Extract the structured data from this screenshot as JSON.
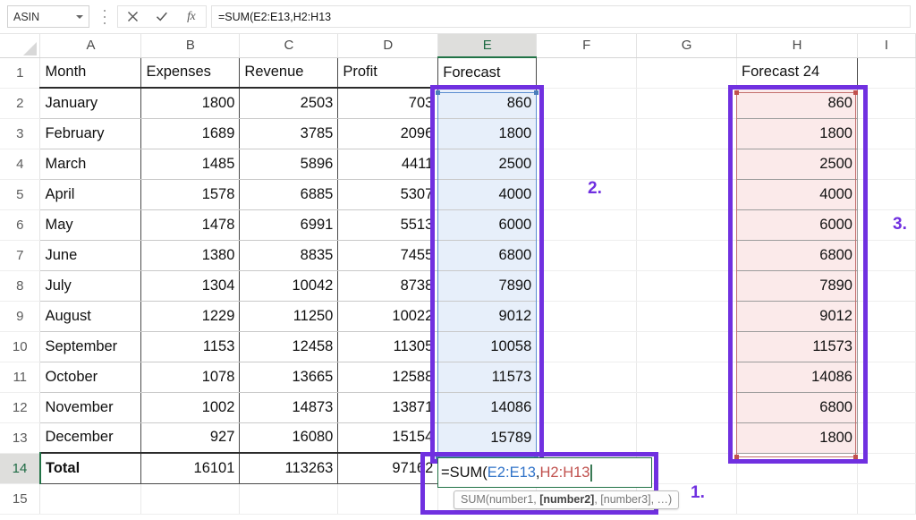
{
  "formula_bar": {
    "name_box_value": "ASIN",
    "cancel_icon": "close-icon",
    "confirm_icon": "check-icon",
    "function_icon": "fx-icon",
    "formula_text": "=SUM(E2:E13,H2:H13"
  },
  "grid": {
    "column_headers": [
      "A",
      "B",
      "C",
      "D",
      "E",
      "F",
      "G",
      "H",
      "I"
    ],
    "active_column": "E",
    "active_row": "14",
    "row_numbers": [
      "1",
      "2",
      "3",
      "4",
      "5",
      "6",
      "7",
      "8",
      "9",
      "10",
      "11",
      "12",
      "13",
      "14",
      "15"
    ],
    "headers_row": {
      "a": "Month",
      "b": "Expenses",
      "c": "Revenue",
      "d": "Profit",
      "e": "Forecast",
      "h": "Forecast 24"
    },
    "rows": [
      {
        "r": "2",
        "month": "January",
        "expenses": "1800",
        "revenue": "2503",
        "profit": "703",
        "forecast": "860",
        "forecast24": "860"
      },
      {
        "r": "3",
        "month": "February",
        "expenses": "1689",
        "revenue": "3785",
        "profit": "2096",
        "forecast": "1800",
        "forecast24": "1800"
      },
      {
        "r": "4",
        "month": "March",
        "expenses": "1485",
        "revenue": "5896",
        "profit": "4411",
        "forecast": "2500",
        "forecast24": "2500"
      },
      {
        "r": "5",
        "month": "April",
        "expenses": "1578",
        "revenue": "6885",
        "profit": "5307",
        "forecast": "4000",
        "forecast24": "4000"
      },
      {
        "r": "6",
        "month": "May",
        "expenses": "1478",
        "revenue": "6991",
        "profit": "5513",
        "forecast": "6000",
        "forecast24": "6000"
      },
      {
        "r": "7",
        "month": "June",
        "expenses": "1380",
        "revenue": "8835",
        "profit": "7455",
        "forecast": "6800",
        "forecast24": "6800"
      },
      {
        "r": "8",
        "month": "July",
        "expenses": "1304",
        "revenue": "10042",
        "profit": "8738",
        "forecast": "7890",
        "forecast24": "7890"
      },
      {
        "r": "9",
        "month": "August",
        "expenses": "1229",
        "revenue": "11250",
        "profit": "10022",
        "forecast": "9012",
        "forecast24": "9012"
      },
      {
        "r": "10",
        "month": "September",
        "expenses": "1153",
        "revenue": "12458",
        "profit": "11305",
        "forecast": "10058",
        "forecast24": "11573"
      },
      {
        "r": "11",
        "month": "October",
        "expenses": "1078",
        "revenue": "13665",
        "profit": "12588",
        "forecast": "11573",
        "forecast24": "14086"
      },
      {
        "r": "12",
        "month": "November",
        "expenses": "1002",
        "revenue": "14873",
        "profit": "13871",
        "forecast": "14086",
        "forecast24": "6800"
      },
      {
        "r": "13",
        "month": "December",
        "expenses": "927",
        "revenue": "16080",
        "profit": "15154",
        "forecast": "15789",
        "forecast24": "1800"
      }
    ],
    "total_row": {
      "r": "14",
      "label": "Total",
      "expenses": "16101",
      "revenue": "113263",
      "profit": "97162"
    }
  },
  "active_cell_edit": {
    "prefix": "=SUM(",
    "ref1": "E2:E13",
    "separator": ",",
    "ref2": "H2:H13"
  },
  "tooltip": {
    "prefix": "SUM(number1, ",
    "bold": "[number2]",
    "suffix": ", [number3], …)"
  },
  "annotations": {
    "one": "1.",
    "two": "2.",
    "three": "3."
  },
  "colors": {
    "annotation_purple": "#7030e0",
    "selection_blue": "#e7effa",
    "selection_pink": "#fbeaea",
    "ref1_blue": "#2f72c8",
    "ref2_red": "#c0504d",
    "excel_green": "#217346"
  }
}
